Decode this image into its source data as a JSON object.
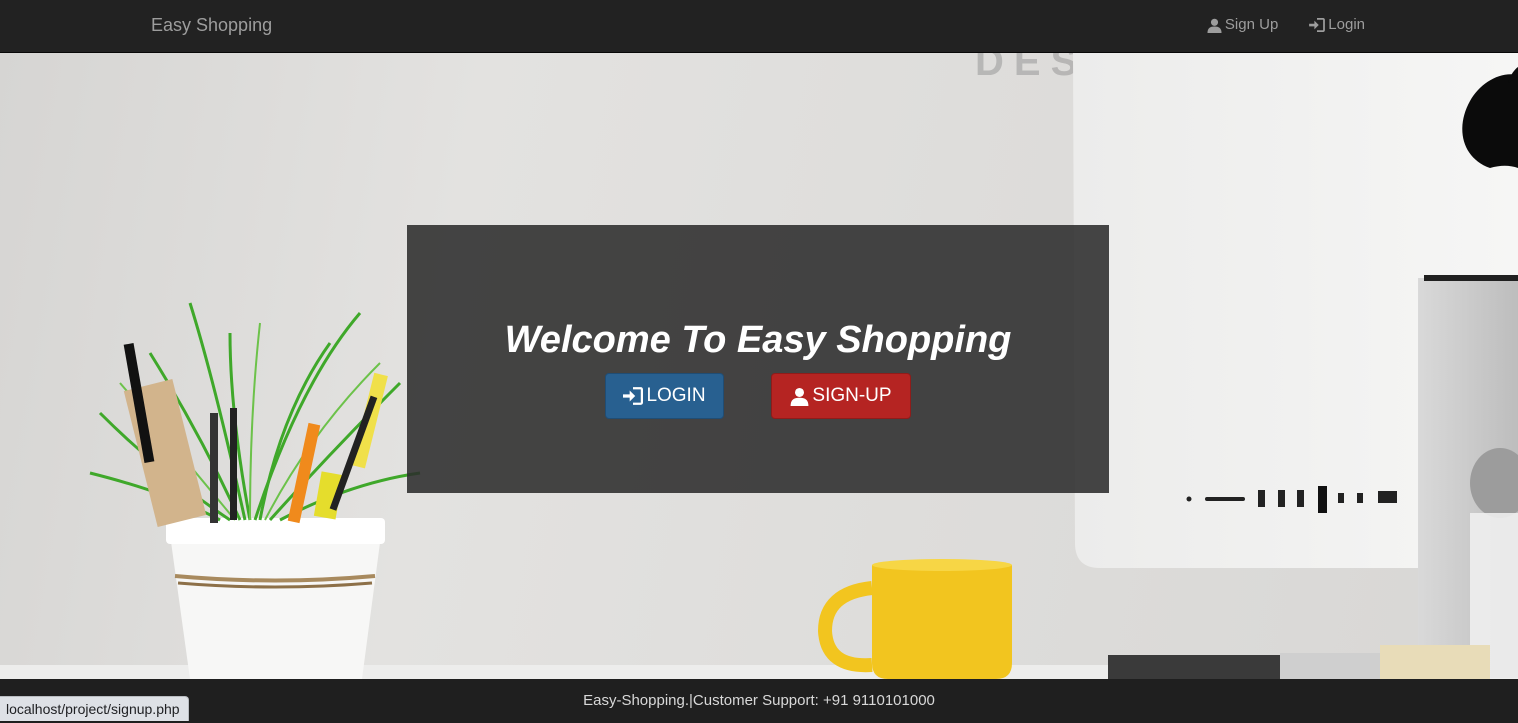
{
  "navbar": {
    "brand": "Easy Shopping",
    "signup_label": "Sign Up",
    "login_label": "Login"
  },
  "hero": {
    "title": "Welcome To Easy Shopping",
    "login_button": "LOGIN",
    "signup_button": "SIGN-UP"
  },
  "footer": {
    "text": "Easy-Shopping.|Customer Support: +91 9110101000"
  },
  "status_bar": {
    "url": "localhost/project/signup.php"
  },
  "icons": {
    "user": "user-icon",
    "login": "log-in-icon"
  },
  "colors": {
    "navbar": "#222222",
    "login_button": "#286090",
    "signup_button": "#b52422",
    "overlay": "#2c2c2c"
  }
}
